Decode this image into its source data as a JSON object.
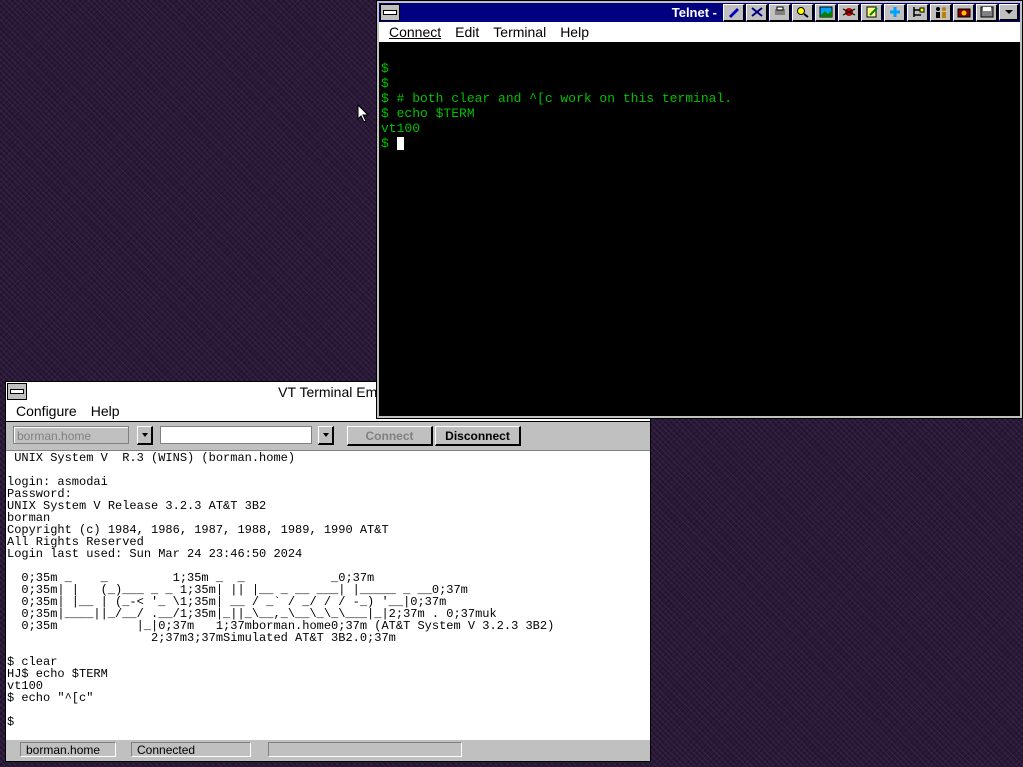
{
  "vt": {
    "title": "VT Terminal Emulat",
    "menu": [
      "Configure",
      "Help"
    ],
    "host_field": "borman.home",
    "port_field": "",
    "connect_label": "Connect",
    "disconnect_label": "Disconnect",
    "screen_text": " UNIX System V  R.3 (WINS) (borman.home)\n\nlogin: asmodai\nPassword:\nUNIX System V Release 3.2.3 AT&T 3B2\nborman\nCopyright (c) 1984, 1986, 1987, 1988, 1989, 1990 AT&T\nAll Rights Reserved\nLogin last used: Sun Mar 24 23:46:50 2024\n\n  0;35m _    _         1;35m _  _            _0;37m\n  0;35m| |   (_)___ _ _ 1;35m| || |__ _ __ ___| |_____ _ __0;37m\n  0;35m| |__ | (_-< '_ \\1;35m| __ / _` / _/ / / -_) '__|0;37m\n  0;35m|____||_/__/ .__/1;35m|_||_\\__,_\\__\\_\\_\\___|_|2;37m . 0;37muk\n  0;35m           |_|0;37m   1;37mborman.home0;37m (AT&T System V 3.2.3 3B2)\n                    2;37m3;37mSimulated AT&T 3B2.0;37m\n\n$ clear\nHJ$ echo $TERM\nvt100\n$ echo \"^[c\"\n\n$",
    "status": [
      "borman.home",
      "Connected",
      ""
    ]
  },
  "telnet": {
    "title": "Telnet -",
    "menu": [
      "Connect",
      "Edit",
      "Terminal",
      "Help"
    ],
    "toolbar_icons": [
      "pen-icon",
      "scissors-icon",
      "print-icon",
      "find-icon",
      "image-icon",
      "bug-icon",
      "edit-icon",
      "plus-icon",
      "tree-icon",
      "people-icon",
      "camera-icon",
      "disk-icon"
    ],
    "screen_text": "\n$\n$\n$ # both clear and ^[c work on this terminal.\n$ echo $TERM\nvt100\n$ "
  }
}
